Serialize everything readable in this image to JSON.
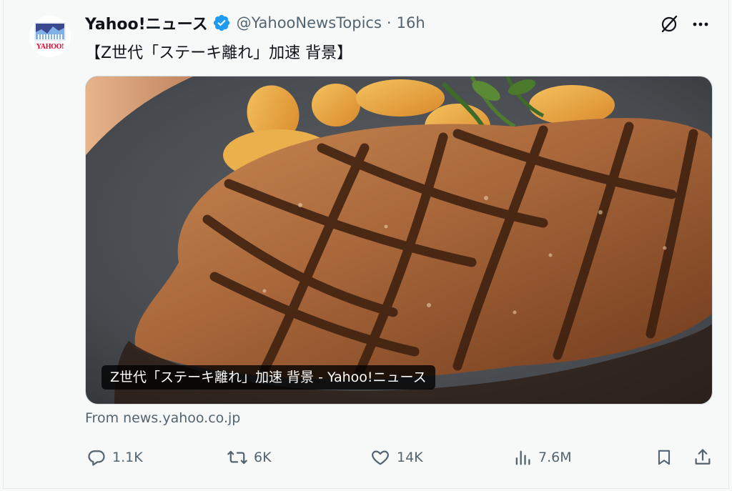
{
  "tweet": {
    "avatar_text": "YAHOO!",
    "display_name": "Yahoo!ニュース",
    "handle": "@YahooNewsTopics",
    "separator": "·",
    "time": "16h",
    "text": "【Z世代「ステーキ離れ」加速 背景】",
    "card": {
      "title": "Z世代「ステーキ離れ」加速 背景 - Yahoo!ニュース",
      "source": "From news.yahoo.co.jp"
    },
    "actions": {
      "replies": "1.1K",
      "reposts": "6K",
      "likes": "14K",
      "views": "7.6M"
    },
    "icons": {
      "verified": "verified-badge-icon",
      "grok": "grok-icon",
      "more": "more-icon",
      "reply": "reply-icon",
      "repost": "repost-icon",
      "like": "heart-icon",
      "views": "views-icon",
      "bookmark": "bookmark-icon",
      "share": "share-icon"
    },
    "colors": {
      "verified": "#1d9bf0",
      "text_secondary": "#536471",
      "brand_red": "#e10028"
    }
  }
}
